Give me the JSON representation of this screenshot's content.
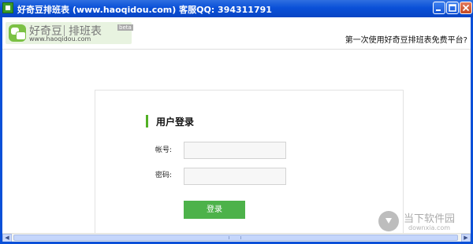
{
  "window": {
    "title": "好奇豆排班表 (www.haoqidou.com)    客服QQ: 394311791"
  },
  "header": {
    "logo_name": "好奇豆",
    "logo_product": "排班表",
    "logo_beta": "beta",
    "logo_url": "www.haoqidou.com",
    "slogan": "第一次使用好奇豆排班表免费平台?"
  },
  "login": {
    "title": "用户登录",
    "account_label": "帐号:",
    "account_value": "",
    "password_label": "密码:",
    "password_value": "",
    "submit_label": "登录"
  },
  "watermark": {
    "name": "当下软件园",
    "url": "downxia.com"
  },
  "colors": {
    "accent_green": "#4db24a",
    "titlebar_blue": "#0a50d8"
  }
}
